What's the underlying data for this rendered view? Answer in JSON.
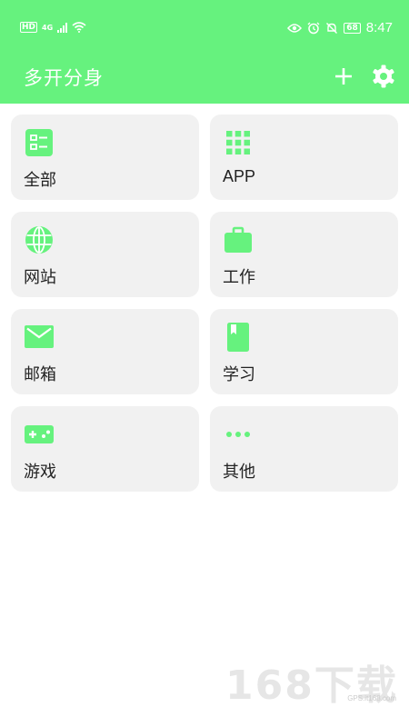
{
  "status_bar": {
    "left_badge": "HD",
    "network": "4G",
    "battery": "68",
    "time": "8:47"
  },
  "app_bar": {
    "title": "多开分身",
    "add_icon": "plus-icon",
    "settings_icon": "gear-icon"
  },
  "categories": [
    {
      "label": "全部",
      "icon": "list-icon"
    },
    {
      "label": "APP",
      "icon": "apps-grid-icon"
    },
    {
      "label": "网站",
      "icon": "globe-icon"
    },
    {
      "label": "工作",
      "icon": "briefcase-icon"
    },
    {
      "label": "邮箱",
      "icon": "mail-icon"
    },
    {
      "label": "学习",
      "icon": "book-icon"
    },
    {
      "label": "游戏",
      "icon": "gamepad-icon"
    },
    {
      "label": "其他",
      "icon": "more-icon"
    }
  ],
  "watermark": {
    "big": "168下载",
    "small": "GPS.it168.com"
  },
  "colors": {
    "accent": "#66f27e",
    "card_bg": "#f1f1f1",
    "text": "#222222"
  }
}
